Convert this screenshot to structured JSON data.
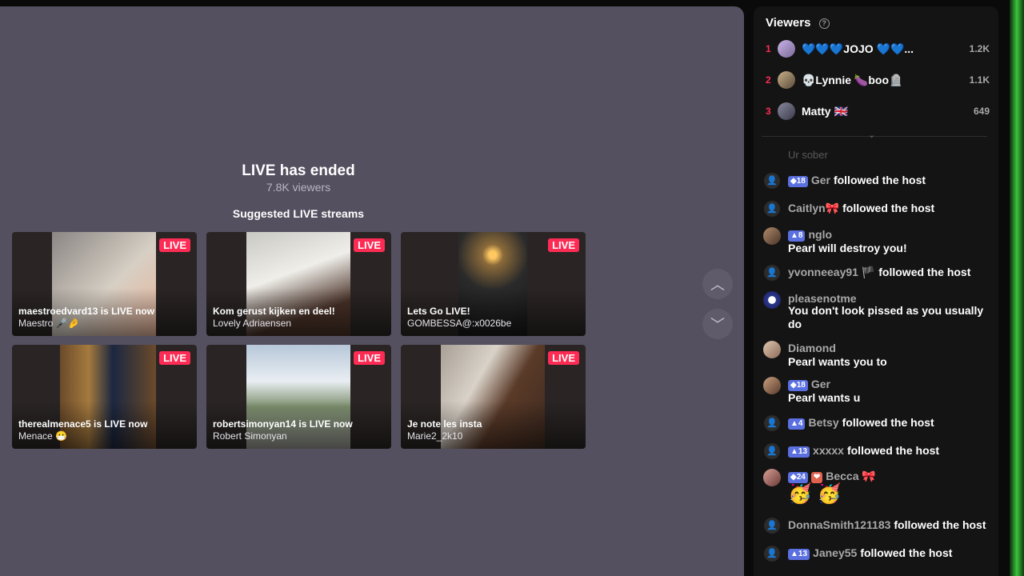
{
  "stream": {
    "ended_title": "LIVE has ended",
    "ended_viewers": "7.8K viewers",
    "suggested_label": "Suggested LIVE streams"
  },
  "suggestions": [
    {
      "badge": "LIVE",
      "title": "maestroedvard13 is LIVE now",
      "host": "Maestro 🎤🤌"
    },
    {
      "badge": "LIVE",
      "title": "Kom gerust kijken en deel!",
      "host": "Lovely Adriaensen"
    },
    {
      "badge": "LIVE",
      "title": "Lets Go LIVE!",
      "host": "GOMBESSA@:x0026be"
    },
    {
      "badge": "LIVE",
      "title": "therealmenace5 is LIVE now",
      "host": "Menace 😷"
    },
    {
      "badge": "LIVE",
      "title": "robertsimonyan14 is LIVE now",
      "host": "Robert Simonyan"
    },
    {
      "badge": "LIVE",
      "title": "Je note les insta",
      "host": "Marie2_2k10"
    }
  ],
  "nav": {
    "up_icon": "chevron-up-icon",
    "down_icon": "chevron-down-icon"
  },
  "viewers": {
    "title": "Viewers",
    "ranking": [
      {
        "rank": "1",
        "name": "💙💙💙JOJO 💙💙...",
        "count": "1.2K"
      },
      {
        "rank": "2",
        "name": "💀Lynnie 🍆boo🪦",
        "count": "1.1K"
      },
      {
        "rank": "3",
        "name": "Matty 🇬🇧",
        "count": "649"
      }
    ]
  },
  "chat": {
    "faded_text": "Ur sober",
    "events": [
      {
        "level": "18",
        "user": "Ger",
        "action": "followed the host"
      },
      {
        "level": "",
        "user": "Caitlyn🎀",
        "action": "followed the host"
      },
      {
        "level": "8",
        "user": "nglo",
        "message": "Pearl will destroy you!"
      },
      {
        "level": "",
        "user": "yvonneeay91 🏴",
        "action": "followed the host"
      },
      {
        "level": "",
        "user": "pleasenotme",
        "message": "You don't look pissed as you usually do"
      },
      {
        "level": "",
        "user": "Diamond",
        "message": "Pearl wants you to"
      },
      {
        "level": "18",
        "user": "Ger",
        "message": "Pearl wants u"
      },
      {
        "level": "4",
        "user": "Betsy",
        "action": "followed the host"
      },
      {
        "level": "13",
        "user": "xxxxx",
        "action": "followed the host"
      },
      {
        "level": "24",
        "badge2": "❤",
        "user": "Becca 🎀",
        "message": "🥳 🥳"
      },
      {
        "level": "",
        "user": "DonnaSmith121183",
        "action": "followed the host"
      },
      {
        "level": "13",
        "user": "Janey55",
        "action": "followed the host"
      }
    ]
  },
  "colors": {
    "live": "#fe2c55",
    "stage": "#545060",
    "panel": "#141414",
    "level_badge": "#5a6fe0"
  }
}
